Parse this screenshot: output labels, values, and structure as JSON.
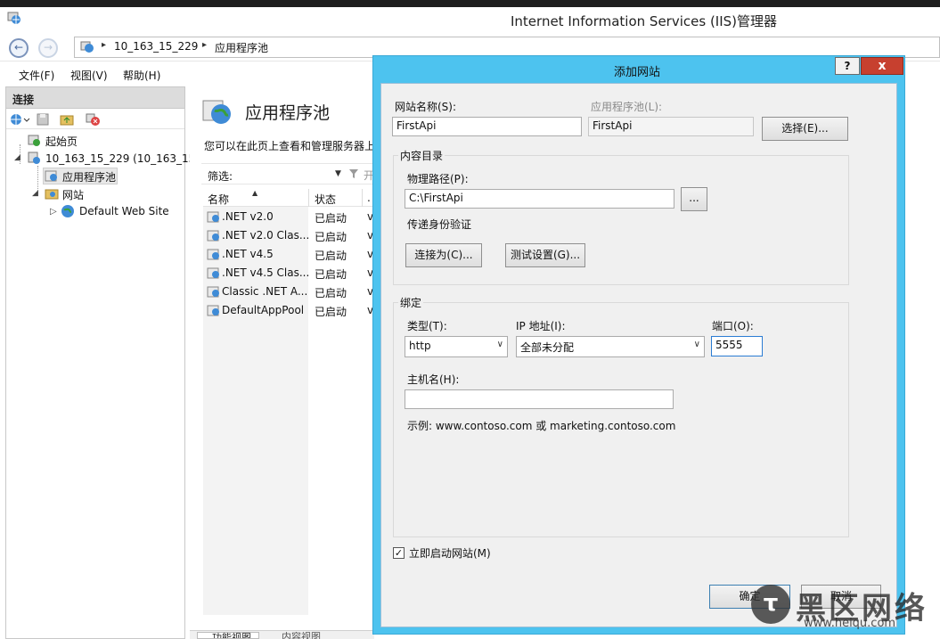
{
  "window": {
    "title": "Internet Information Services (IIS)管理器"
  },
  "address": {
    "crumbs": [
      "10_163_15_229",
      "应用程序池"
    ]
  },
  "menu": {
    "items": [
      "文件(F)",
      "视图(V)",
      "帮助(H)"
    ]
  },
  "connections": {
    "title": "连接",
    "tree": {
      "start_page": "起始页",
      "server": "10_163_15_229 (10_163_15_",
      "app_pools": "应用程序池",
      "sites": "网站",
      "default_site": "Default Web Site"
    }
  },
  "main": {
    "heading": "应用程序池",
    "description": "您可以在此页上查看和管理服务器上",
    "filter_label": "筛选:",
    "filter_go": "开",
    "columns": [
      "名称",
      "状态",
      "."
    ],
    "rows": [
      {
        "name": ".NET v2.0",
        "status": "已启动",
        "v": "v"
      },
      {
        "name": ".NET v2.0 Clas...",
        "status": "已启动",
        "v": "v"
      },
      {
        "name": ".NET v4.5",
        "status": "已启动",
        "v": "v"
      },
      {
        "name": ".NET v4.5 Clas...",
        "status": "已启动",
        "v": "v"
      },
      {
        "name": "Classic .NET A...",
        "status": "已启动",
        "v": "v"
      },
      {
        "name": "DefaultAppPool",
        "status": "已启动",
        "v": "v"
      }
    ],
    "bottom_tabs": [
      "功能视图",
      "内容视图"
    ]
  },
  "dialog": {
    "title": "添加网站",
    "help": "?",
    "close": "x",
    "site_name_label": "网站名称(S):",
    "site_name_value": "FirstApi",
    "app_pool_label": "应用程序池(L):",
    "app_pool_value": "FirstApi",
    "select_button": "选择(E)...",
    "content_dir_label": "内容目录",
    "physical_path_label": "物理路径(P):",
    "physical_path_value": "C:\\FirstApi",
    "browse_button": "...",
    "pass_through_label": "传递身份验证",
    "connect_as_button": "连接为(C)...",
    "test_settings_button": "测试设置(G)...",
    "binding_label": "绑定",
    "type_label": "类型(T):",
    "type_value": "http",
    "ip_label": "IP 地址(I):",
    "ip_value": "全部未分配",
    "port_label": "端口(O):",
    "port_value": "5555",
    "host_label": "主机名(H):",
    "host_value": "",
    "example_text": "示例: www.contoso.com 或 marketing.contoso.com",
    "start_now_label": "立即启动网站(M)",
    "start_now_checked": true,
    "ok_button": "确定",
    "cancel_button": "取消"
  },
  "watermark": {
    "text": "黑区网络",
    "url": "www.heiqu.com"
  }
}
